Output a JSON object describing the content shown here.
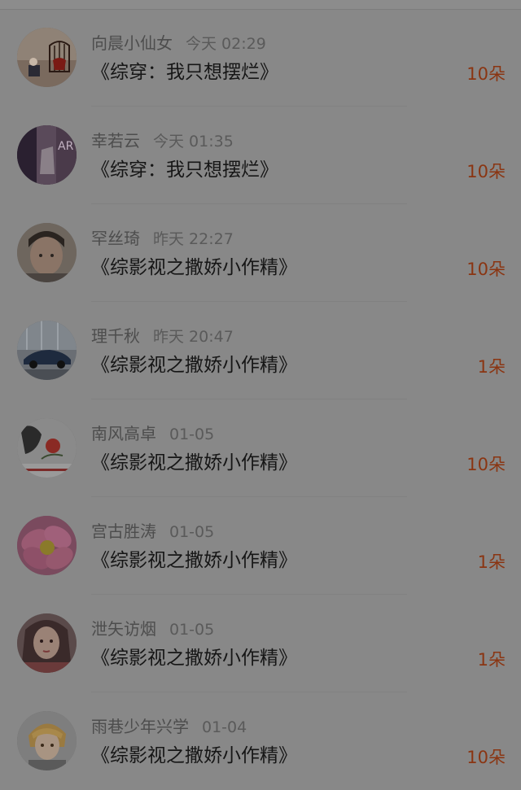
{
  "colors": {
    "overlay_background": "#888888",
    "flower_count": "#8a3512",
    "book_title": "#161616",
    "user_name": "#4d4d4d"
  },
  "gift_list": [
    {
      "user": "向晨小仙女",
      "time": "今天 02:29",
      "book": "《综穿：我只想摆烂》",
      "count": "10朵",
      "avatar_icon": "birdcage-avatar"
    },
    {
      "user": "幸若云",
      "time": "今天 01:35",
      "book": "《综穿：我只想摆烂》",
      "count": "10朵",
      "avatar_icon": "poster-avatar"
    },
    {
      "user": "罕丝琦",
      "time": "昨天 22:27",
      "book": "《综影视之撒娇小作精》",
      "count": "10朵",
      "avatar_icon": "girl-face-avatar"
    },
    {
      "user": "理千秋",
      "time": "昨天 20:47",
      "book": "《综影视之撒娇小作精》",
      "count": "1朵",
      "avatar_icon": "car-avatar"
    },
    {
      "user": "南风高卓",
      "time": "01-05",
      "book": "《综影视之撒娇小作精》",
      "count": "10朵",
      "avatar_icon": "rose-avatar"
    },
    {
      "user": "宫古胜涛",
      "time": "01-05",
      "book": "《综影视之撒娇小作精》",
      "count": "1朵",
      "avatar_icon": "flower-avatar"
    },
    {
      "user": "泄矢访烟",
      "time": "01-05",
      "book": "《综影视之撒娇小作精》",
      "count": "1朵",
      "avatar_icon": "woman-portrait-avatar"
    },
    {
      "user": "雨巷少年兴学",
      "time": "01-04",
      "book": "《综影视之撒娇小作精》",
      "count": "10朵",
      "avatar_icon": "anime-boy-avatar"
    }
  ]
}
